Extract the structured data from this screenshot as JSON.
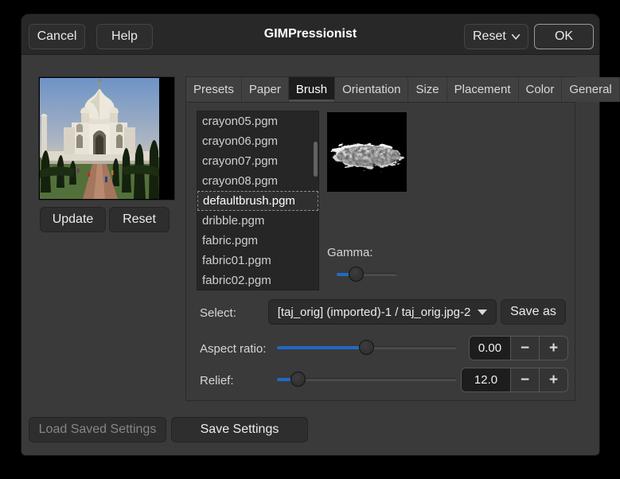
{
  "window": {
    "title": "GIMPressionist"
  },
  "header": {
    "cancel_label": "Cancel",
    "help_label": "Help",
    "reset_label": "Reset",
    "ok_label": "OK"
  },
  "preview_panel": {
    "update_label": "Update",
    "reset_label": "Reset",
    "image_name": "taj-mahal-preview"
  },
  "tabs": [
    "Presets",
    "Paper",
    "Brush",
    "Orientation",
    "Size",
    "Placement",
    "Color",
    "General"
  ],
  "active_tab": "Brush",
  "brush_tab": {
    "files": [
      "crayon05.pgm",
      "crayon06.pgm",
      "crayon07.pgm",
      "crayon08.pgm",
      "defaultbrush.pgm",
      "dribble.pgm",
      "fabric.pgm",
      "fabric01.pgm",
      "fabric02.pgm"
    ],
    "selected_file": "defaultbrush.pgm",
    "gamma_label": "Gamma:",
    "select_label": "Select:",
    "select_value": "[taj_orig] (imported)-1 / taj_orig.jpg-2",
    "save_as_label": "Save as",
    "aspect_ratio_label": "Aspect ratio:",
    "aspect_ratio_value": "0.00",
    "relief_label": "Relief:",
    "relief_value": "12.0",
    "spin_minus": "−",
    "spin_plus": "+"
  },
  "sliders": {
    "gamma_percent": 33,
    "aspect_ratio_percent": 50,
    "relief_percent": 12
  },
  "footer": {
    "load_label": "Load Saved Settings",
    "load_enabled": false,
    "save_label": "Save Settings"
  },
  "colors": {
    "accent_blue": "#2368c4",
    "dialog_bg": "#3a3a3a",
    "header_bg": "#282828",
    "list_bg": "#262626",
    "active_tab_bg": "#1d1d1d"
  }
}
